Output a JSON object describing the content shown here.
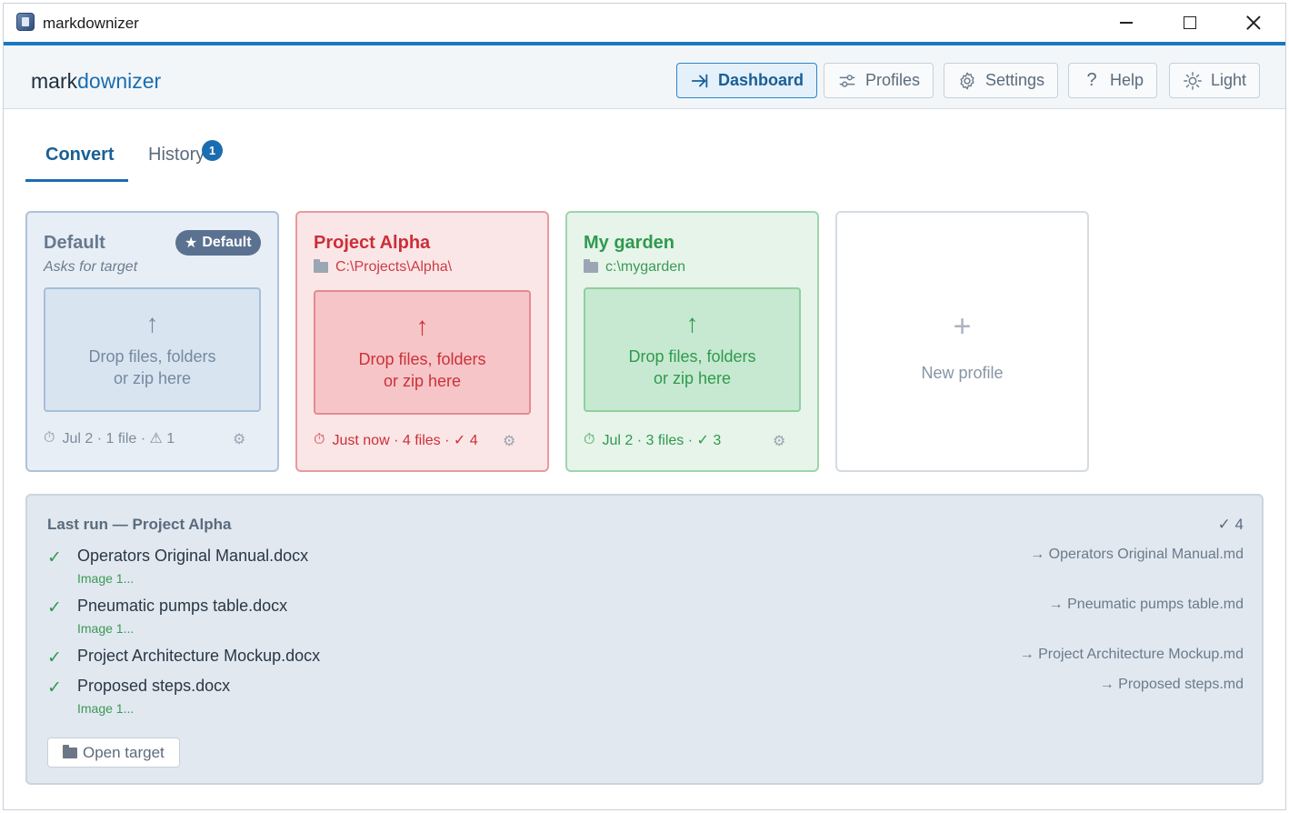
{
  "window": {
    "title": "markdownizer"
  },
  "brand": {
    "part1": "mark",
    "part2": "downizer"
  },
  "nav": {
    "dashboard": "Dashboard",
    "profiles": "Profiles",
    "settings": "Settings",
    "help": "Help",
    "theme": "Light"
  },
  "tabs": {
    "convert": "Convert",
    "history": "History",
    "history_badge": "1"
  },
  "profiles": {
    "default": {
      "name": "Default",
      "subtitle": "Asks for target",
      "badge": "Default",
      "drop_line1": "Drop files, folders",
      "drop_line2": "or zip here",
      "footer": "Jul 2 · 1 file · ⚠ 1"
    },
    "alpha": {
      "name": "Project Alpha",
      "path": "C:\\Projects\\Alpha\\",
      "drop_line1": "Drop files, folders",
      "drop_line2": "or zip here",
      "footer": "Just now · 4 files · ✓ 4"
    },
    "garden": {
      "name": "My garden",
      "path": "c:\\mygarden",
      "drop_line1": "Drop files, folders",
      "drop_line2": "or zip here",
      "footer": "Jul 2 · 3 files · ✓ 3"
    },
    "new": {
      "label": "New profile"
    }
  },
  "last_run": {
    "title": "Last run — Project Alpha",
    "count": "✓ 4",
    "items": [
      {
        "file": "Operators Original Manual.docx",
        "target": "→ Operators Original Manual.md",
        "note": "Image 1..."
      },
      {
        "file": "Pneumatic pumps table.docx",
        "target": "→ Pneumatic pumps table.md",
        "note": "Image 1..."
      },
      {
        "file": "Project Architecture Mockup.docx",
        "target": "→ Project Architecture Mockup.md",
        "note": ""
      },
      {
        "file": "Proposed steps.docx",
        "target": "→ Proposed steps.md",
        "note": "Image 1..."
      }
    ],
    "open_target": "Open target"
  },
  "colors": {
    "accent": "#1a78c2",
    "error": "#cc2f38",
    "success": "#2f9a4d",
    "neutral": "#5a7290"
  }
}
